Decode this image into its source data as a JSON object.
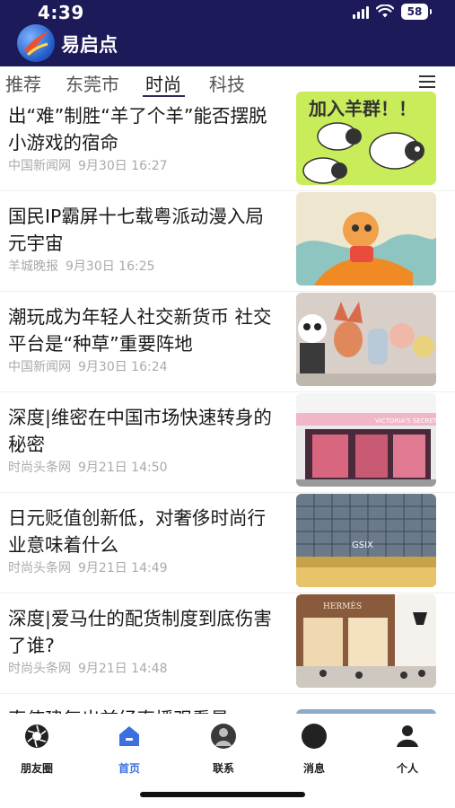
{
  "status_bar": {
    "time": "4:39",
    "battery": "58"
  },
  "app": {
    "name": "易启点"
  },
  "tabs": [
    {
      "label": "推荐"
    },
    {
      "label": "东莞市"
    },
    {
      "label": "时尚"
    },
    {
      "label": "科技"
    }
  ],
  "active_tab": "时尚",
  "news": [
    {
      "title": "出“难”制胜“羊了个羊”能否摆脱小游戏的宿命",
      "source": "中国新闻网",
      "time": "9月30日 16:27",
      "image_text": "加入羊群！！"
    },
    {
      "title": "国民IP霸屏十七载粤派动漫入局元宇宙",
      "source": "羊城晚报",
      "time": "9月30日 16:25"
    },
    {
      "title": "潮玩成为年轻人社交新货币 社交平台是“种草”重要阵地",
      "source": "中国新闻网",
      "time": "9月30日 16:24"
    },
    {
      "title": "深度|维密在中国市场快速转身的秘密",
      "source": "时尚头条网",
      "time": "9月21日 14:50",
      "image_text": "VICTORIA'S SECRET"
    },
    {
      "title": "日元贬值创新低，对奢侈时尚行业意味着什么",
      "source": "时尚头条网",
      "time": "9月21日 14:49",
      "image_text": "GSIX"
    },
    {
      "title": "深度|爱马仕的配货制度到底伤害了谁?",
      "source": "时尚头条网",
      "time": "9月21日 14:48",
      "image_text": "HERMÈS"
    },
    {
      "title": "直使建复出前经直播观看最"
    }
  ],
  "bottom_nav": [
    {
      "label": "朋友圈",
      "icon": "camera-shutter-icon"
    },
    {
      "label": "首页",
      "icon": "home-icon",
      "active": true
    },
    {
      "label": "联系",
      "icon": "contact-avatar-icon"
    },
    {
      "label": "消息",
      "icon": "message-icon"
    },
    {
      "label": "个人",
      "icon": "person-icon"
    }
  ],
  "colors": {
    "header_bg": "#1d1a5a",
    "active_nav": "#3c6fe0"
  }
}
